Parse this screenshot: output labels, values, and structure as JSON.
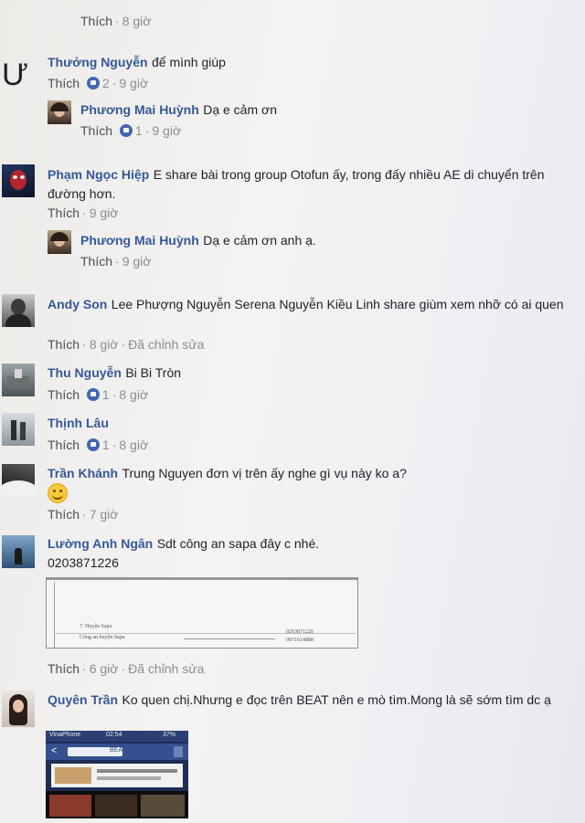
{
  "top_meta": {
    "like": "Thích",
    "time": "8 giờ"
  },
  "comments": [
    {
      "name": "Thưởng Nguyễn",
      "text": "để mình giúp",
      "like": "Thích",
      "likes": "2",
      "time": "9 giờ",
      "avatar_letter": "Ư"
    },
    {
      "name": "Phương Mai Huỳnh",
      "text": "Dạ e cảm ơn",
      "like": "Thích",
      "likes": "1",
      "time": "9 giờ"
    },
    {
      "name": "Phạm Ngọc Hiệp",
      "text": "E share bài trong group Otofun ấy, trong đấy nhiều AE di chuyển trên đường hơn.",
      "like": "Thích",
      "time": "9 giờ"
    },
    {
      "name": "Phương Mai Huỳnh",
      "text": "Dạ e cảm ơn anh ạ.",
      "like": "Thích",
      "time": "9 giờ"
    },
    {
      "name": "Andy Son",
      "text": "Lee Phượng Nguyễn Serena Nguyễn Kiều Linh share giùm xem nhỡ có ai quen",
      "like": "Thích",
      "time": "8 giờ",
      "edited": "Đã chỉnh sửa"
    },
    {
      "name": "Thu Nguyễn",
      "text": "Bi Bi Tròn",
      "like": "Thích",
      "likes": "1",
      "time": "8 giờ"
    },
    {
      "name": "Thịnh Lâu",
      "text": "",
      "like": "Thích",
      "likes": "1",
      "time": "8 giờ"
    },
    {
      "name": "Trần Khánh",
      "text": "Trung Nguyen đơn vị trên ấy nghe gì vụ này ko a?",
      "like": "Thích",
      "time": "7 giờ"
    },
    {
      "name": "Lường Anh Ngân",
      "text": "Sdt công an sapa đây c nhé.",
      "phone": "0203871226",
      "like": "Thích",
      "time": "6 giờ",
      "edited": "Đã chỉnh sửa"
    },
    {
      "name": "Quyên Trần",
      "text": "Ko quen chị.Nhưng e đọc trên BEAT nên e mò tìm.Mong là sẽ sớm tìm dc ạ"
    }
  ],
  "attachment": {
    "row1": "7. Huyện Sapa",
    "row2": "Công an huyện Sapa",
    "phone1": "0203871226",
    "phone2": "0971614888"
  },
  "phone_shot": {
    "carrier": "VinaPhone",
    "clock": "02:54",
    "battery": "37%",
    "app_label": "BEAT"
  },
  "colors": {
    "name": "#365899",
    "meta": "#8a8d91",
    "like_badge": "#4267b2"
  },
  "icons": [
    "like-reaction-icon",
    "smile-emoji-icon"
  ]
}
